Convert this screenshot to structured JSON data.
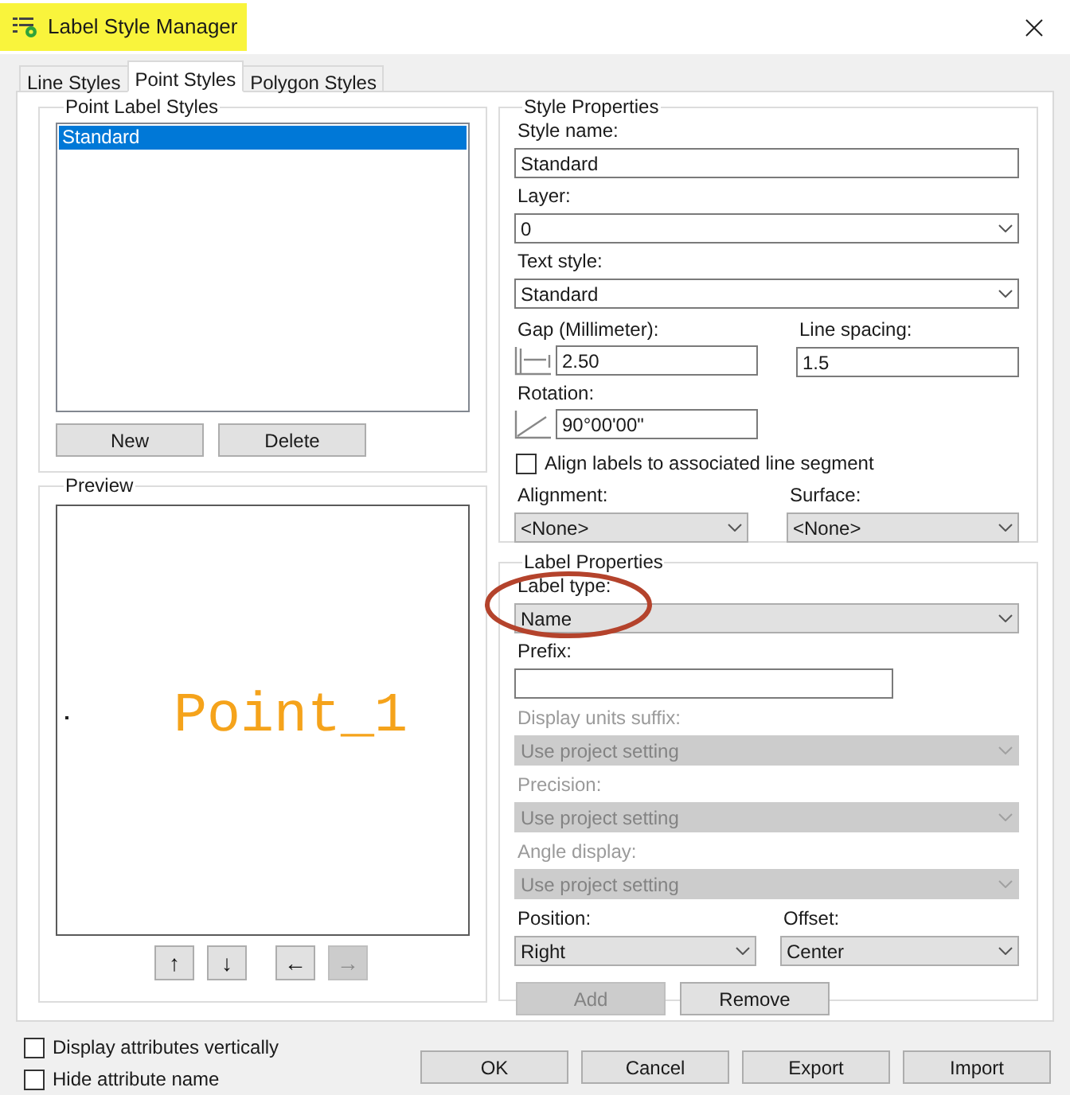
{
  "window": {
    "title": "Label Style Manager",
    "highlighted": true
  },
  "tabs": [
    {
      "label": "Line Styles",
      "selected": false
    },
    {
      "label": "Point Styles",
      "selected": true
    },
    {
      "label": "Polygon Styles",
      "selected": false
    }
  ],
  "point_label_styles": {
    "title": "Point Label Styles",
    "items": [
      {
        "label": "Standard",
        "selected": true
      }
    ],
    "buttons": [
      {
        "label": "New",
        "disabled": false
      },
      {
        "label": "Delete",
        "disabled": false
      }
    ]
  },
  "preview": {
    "title": "Preview",
    "label_text": "Point_1",
    "buttons": [
      {
        "glyph": "↑",
        "disabled": false
      },
      {
        "glyph": "↓",
        "disabled": false
      },
      {
        "glyph": "←",
        "disabled": false
      },
      {
        "glyph": "→",
        "disabled": true
      }
    ]
  },
  "style_properties": {
    "title": "Style Properties",
    "style_name": {
      "label": "Style name:",
      "kind": "text",
      "value": "Standard",
      "disabled": false
    },
    "layer": {
      "label": "Layer:",
      "kind": "combo",
      "value": "0",
      "disabled": false
    },
    "text_style": {
      "label": "Text style:",
      "kind": "combo",
      "value": "Standard",
      "disabled": false
    },
    "gap": {
      "label": "Gap (Millimeter):",
      "kind": "text",
      "value": "2.50",
      "disabled": false
    },
    "line_spacing": {
      "label": "Line spacing:",
      "kind": "text",
      "value": "1.5",
      "disabled": false
    },
    "rotation": {
      "label": "Rotation:",
      "kind": "text",
      "value": "90°00'00\"",
      "disabled": false
    },
    "align_to_segment": {
      "label": "Align labels to associated line segment",
      "checked": false
    },
    "alignment": {
      "label": "Alignment:",
      "kind": "dropdown",
      "value": "<None>",
      "disabled": false
    },
    "surface": {
      "label": "Surface:",
      "kind": "dropdown",
      "value": "<None>",
      "disabled": false
    }
  },
  "label_properties": {
    "title": "Label Properties",
    "label_type": {
      "label": "Label type:",
      "kind": "dropdown",
      "value": "Name",
      "disabled": false
    },
    "prefix": {
      "label": "Prefix:",
      "kind": "text",
      "disabled": false
    },
    "display_units_suffix": {
      "label": "Display units suffix:",
      "kind": "dropdown",
      "value": "Use project setting",
      "disabled": true
    },
    "precision": {
      "label": "Precision:",
      "kind": "dropdown",
      "value": "Use project setting",
      "disabled": true
    },
    "angle_display": {
      "label": "Angle display:",
      "kind": "dropdown",
      "value": "Use project setting",
      "disabled": true
    },
    "position": {
      "label": "Position:",
      "kind": "dropdown",
      "value": "Right",
      "disabled": false
    },
    "offset": {
      "label": "Offset:",
      "kind": "dropdown",
      "value": "Center",
      "disabled": false
    },
    "buttons": [
      {
        "label": "Add",
        "disabled": true
      },
      {
        "label": "Remove",
        "disabled": false
      }
    ]
  },
  "options": [
    {
      "label": "Display attributes vertically",
      "checked": false
    },
    {
      "label": "Hide attribute name",
      "checked": false
    }
  ],
  "buttons": [
    {
      "label": "OK",
      "disabled": false
    },
    {
      "label": "Cancel",
      "disabled": false
    },
    {
      "label": "Export",
      "disabled": false
    },
    {
      "label": "Import",
      "disabled": false
    }
  ],
  "annotation": {
    "kind": "ellipse"
  }
}
